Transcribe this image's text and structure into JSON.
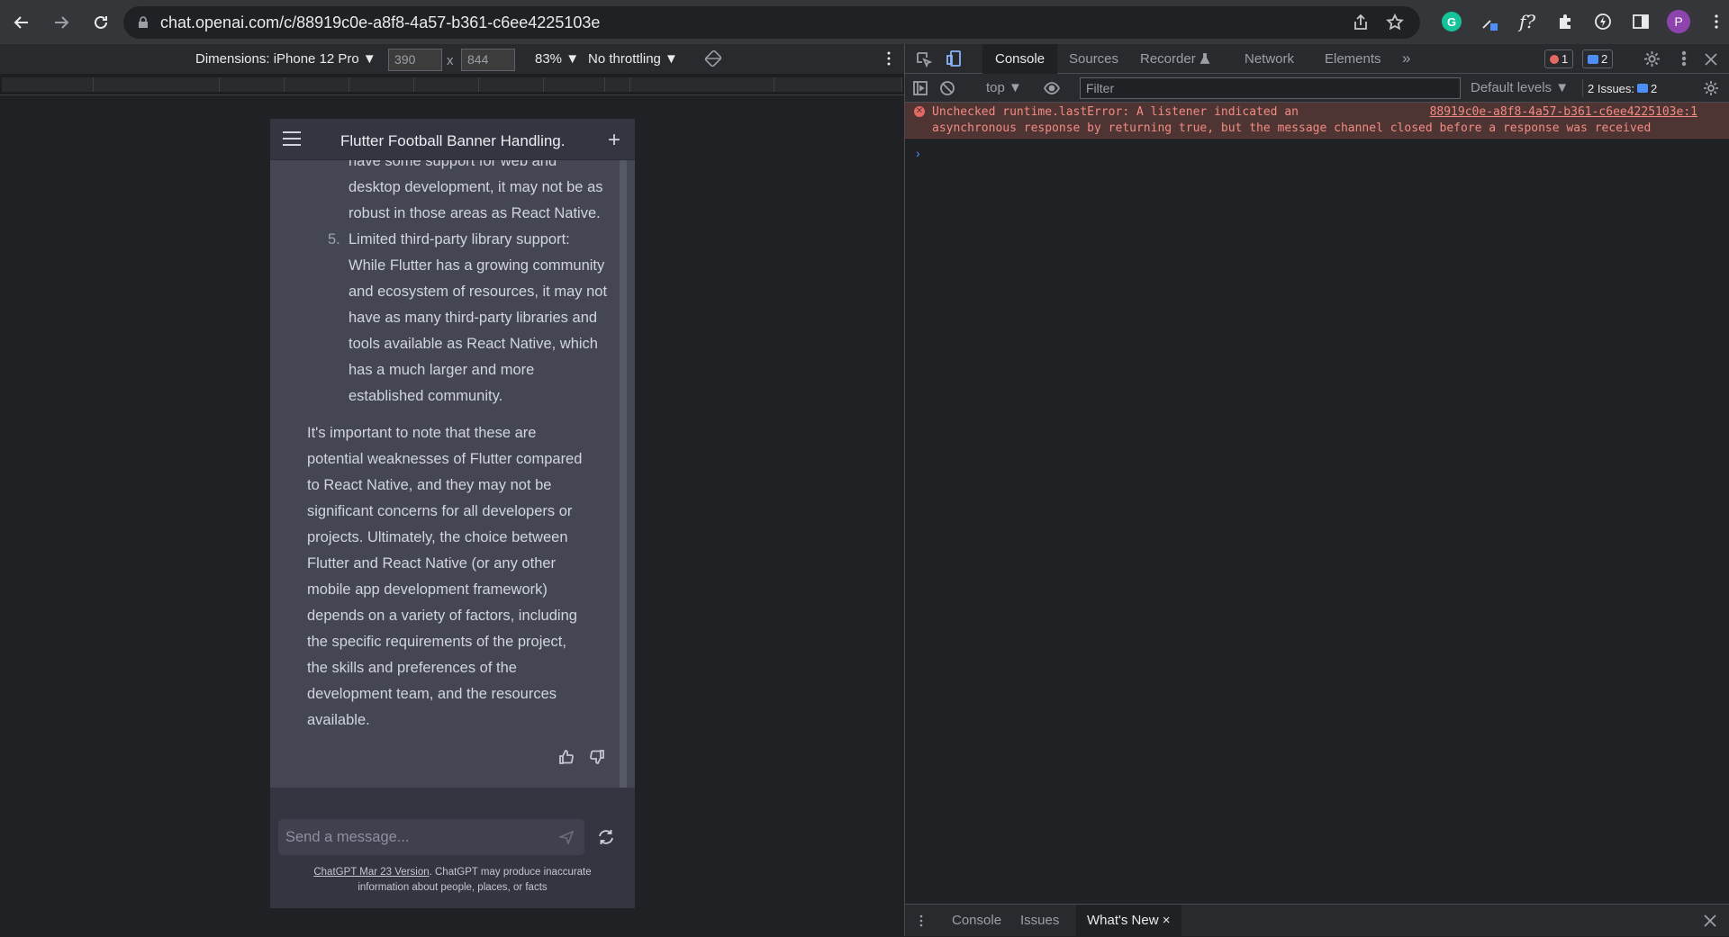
{
  "browser": {
    "url": "chat.openai.com/c/88919c0e-a8f8-4a57-b361-c6ee4225103e",
    "profile_initial": "P",
    "grammarly_letter": "G",
    "f_ext": "f?"
  },
  "device_toolbar": {
    "dimensions_label": "Dimensions: iPhone 12 Pro ▼",
    "width": "390",
    "height": "844",
    "times": "x",
    "zoom": "83% ▼",
    "throttling": "No throttling ▼"
  },
  "phone": {
    "title": "Flutter Football Banner Handling.",
    "plus": "+",
    "partial_line": "have some support for web and",
    "list_item_4_rest": [
      "desktop development, it may not be as",
      "robust in those areas as React Native."
    ],
    "list_item_5_marker": "5.",
    "list_item_5_lines": [
      "Limited third-party library support:",
      "While Flutter has a growing community",
      "and ecosystem of resources, it may not",
      "have as many third-party libraries and",
      "tools available as React Native, which",
      "has a much larger and more",
      "established community."
    ],
    "paragraph_lines": [
      "It's important to note that these are",
      "potential weaknesses of Flutter compared",
      "to React Native, and they may not be",
      "significant concerns for all developers or",
      "projects. Ultimately, the choice between",
      "Flutter and React Native (or any other",
      "mobile app development framework)",
      "depends on a variety of factors, including",
      "the specific requirements of the project,",
      "the skills and preferences of the",
      "development team, and the resources",
      "available."
    ],
    "input_placeholder": "Send a message...",
    "disclaimer_link": "ChatGPT Mar 23 Version",
    "disclaimer_text_1": ". ChatGPT may produce inaccurate",
    "disclaimer_text_2": "information about people, places, or facts"
  },
  "devtools": {
    "tabs": [
      "Console",
      "Sources",
      "Recorder",
      "Network",
      "Elements"
    ],
    "more_tabs": "»",
    "error_count": "1",
    "message_count": "2",
    "context": "top ▼",
    "filter_placeholder": "Filter",
    "levels": "Default levels ▼",
    "issues_label": "2 Issues:",
    "issues_count": "2",
    "error_line_1": "Unchecked runtime.lastError: A listener indicated an",
    "error_line_2": "asynchronous response by returning true, but the message channel closed before a response was received",
    "error_source": "88919c0e-a8f8-4a57-b361-c6ee4225103e:1",
    "prompt": "›",
    "drawer_tabs": [
      "Console",
      "Issues",
      "What's New"
    ],
    "drawer_close": "×"
  },
  "colors": {
    "chat_bg": "#444654",
    "header_bg": "#343541",
    "error_bg": "#4e3534",
    "error_text": "#f28b82"
  }
}
